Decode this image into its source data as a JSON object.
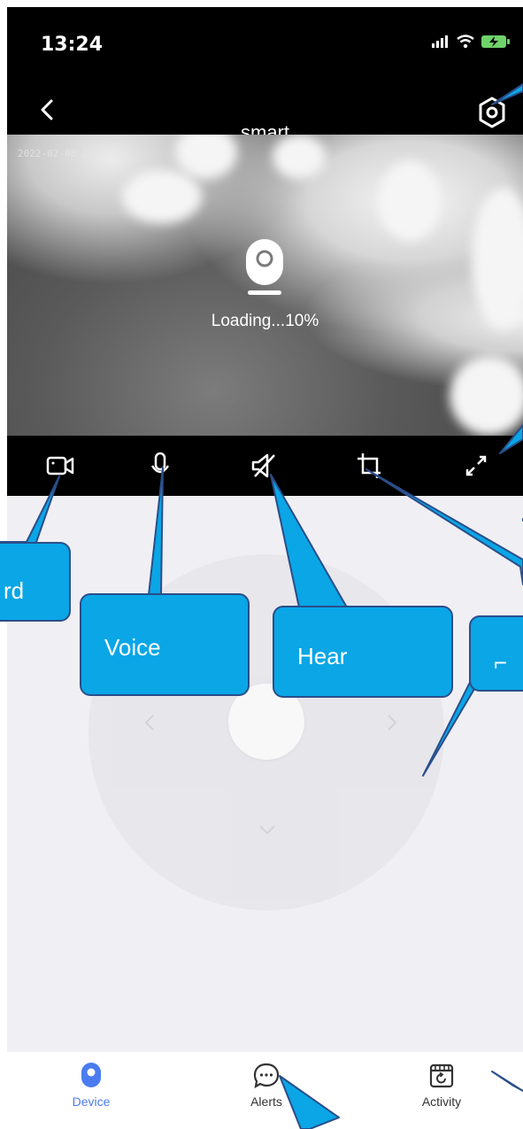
{
  "status_bar": {
    "time": "13:24"
  },
  "nav": {
    "title": "smart"
  },
  "video": {
    "timestamp": "2022-02-08 13:52:34",
    "loading_text": "Loading...10%"
  },
  "controls": [
    {
      "name": "record-button",
      "icon": "video-camera-icon"
    },
    {
      "name": "voice-button",
      "icon": "microphone-icon"
    },
    {
      "name": "hear-button",
      "icon": "speaker-muted-icon"
    },
    {
      "name": "crop-button",
      "icon": "crop-icon"
    },
    {
      "name": "fullscreen-button",
      "icon": "expand-icon"
    }
  ],
  "ptz": {
    "icons": [
      "chevron-left-icon",
      "chevron-right-icon",
      "chevron-down-icon"
    ]
  },
  "tab_bar": {
    "tabs": [
      {
        "label": "Device",
        "icon": "camera-icon",
        "active": true
      },
      {
        "label": "Alerts",
        "icon": "chat-bubble-icon",
        "active": false
      },
      {
        "label": "Activity",
        "icon": "calendar-replay-icon",
        "active": false
      }
    ]
  },
  "callouts": {
    "record": "rd",
    "voice": "Voice",
    "hear": "Hear",
    "ptz": "⌐"
  },
  "colors": {
    "accent": "#4a7cf0",
    "callout_fill": "#0aa6e6",
    "callout_border": "#2a4e8a",
    "bar_bg": "#000000",
    "page_bg": "#f0eff4"
  }
}
